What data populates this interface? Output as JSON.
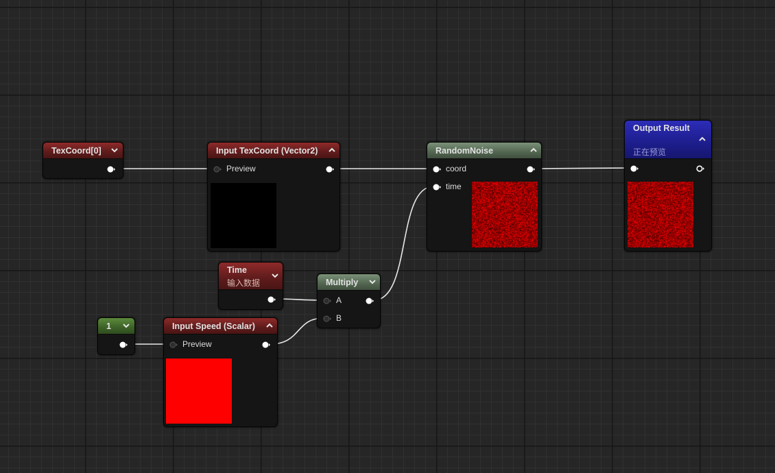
{
  "nodes": {
    "texcoord": {
      "title": "TexCoord[0]"
    },
    "input_texcoord": {
      "title": "Input TexCoord (Vector2)",
      "preview_label": "Preview"
    },
    "random_noise": {
      "title": "RandomNoise",
      "coord_label": "coord",
      "time_label": "time"
    },
    "output_result": {
      "title": "Output Result",
      "subtitle": "正在预览"
    },
    "time": {
      "title": "Time",
      "subtitle": "输入数据"
    },
    "multiply": {
      "title": "Multiply",
      "a_label": "A",
      "b_label": "B"
    },
    "constant": {
      "title": "1"
    },
    "input_speed": {
      "title": "Input Speed (Scalar)",
      "preview_label": "Preview"
    }
  },
  "colors": {
    "canvas_bg": "#262626",
    "texcoord_preview": "#000000",
    "speed_preview": "#ff0000",
    "noise_red": "#e00000",
    "wire": "#ffffff"
  },
  "icons": {
    "collapse": "chevron-up-icon",
    "expand": "chevron-down-icon",
    "output_pin": "filled-circle-pin-icon",
    "input_pin": "hollow-circle-pin-icon"
  }
}
